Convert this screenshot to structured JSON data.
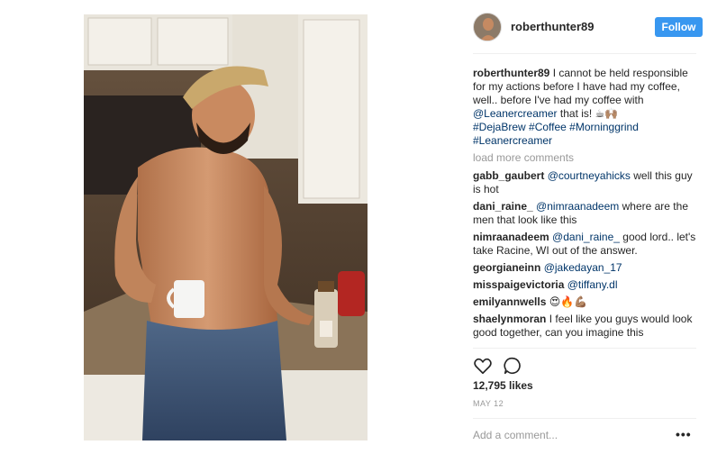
{
  "post": {
    "author": "roberthunter89",
    "follow_label": "Follow",
    "caption": {
      "user": "roberthunter89",
      "text_1": "I cannot be held responsible for my actions before I have had my coffee, well.. before I've had my coffee with ",
      "mention": "@Leanercreamer",
      "text_2": " that is! ☕🙌🏽",
      "hashtags": "#DejaBrew #Coffee #Morninggrind #Leanercreamer"
    },
    "load_more": "load more comments",
    "comments": [
      {
        "user": "gabb_gaubert",
        "mention": "@courtneyahicks",
        "text": " well this guy is hot"
      },
      {
        "user": "dani_raine_",
        "mention": "@nimraanadeem",
        "text": " where are the men that look like this"
      },
      {
        "user": "nimraanadeem",
        "mention": "@dani_raine_",
        "text": " good lord.. let's take Racine, WI out of the answer."
      },
      {
        "user": "georgianeinn",
        "mention": "@jakedayan_17",
        "text": ""
      },
      {
        "user": "misspaigevictoria",
        "mention": "@tiffany.dl",
        "text": ""
      },
      {
        "user": "emilyannwells",
        "mention": "",
        "text": "😍🔥💪🏽"
      },
      {
        "user": "shaelynmoran",
        "mention": "",
        "text": "I feel like you guys would look good together, can you imagine this"
      }
    ],
    "likes": "12,795 likes",
    "date": "MAY 12",
    "add_comment_placeholder": "Add a comment...",
    "more_options": "•••",
    "icons": {
      "like": "heart-icon",
      "comment": "comment-bubble-icon"
    },
    "colors": {
      "follow": "#3897f0",
      "link": "#003569",
      "muted": "#999999"
    }
  }
}
